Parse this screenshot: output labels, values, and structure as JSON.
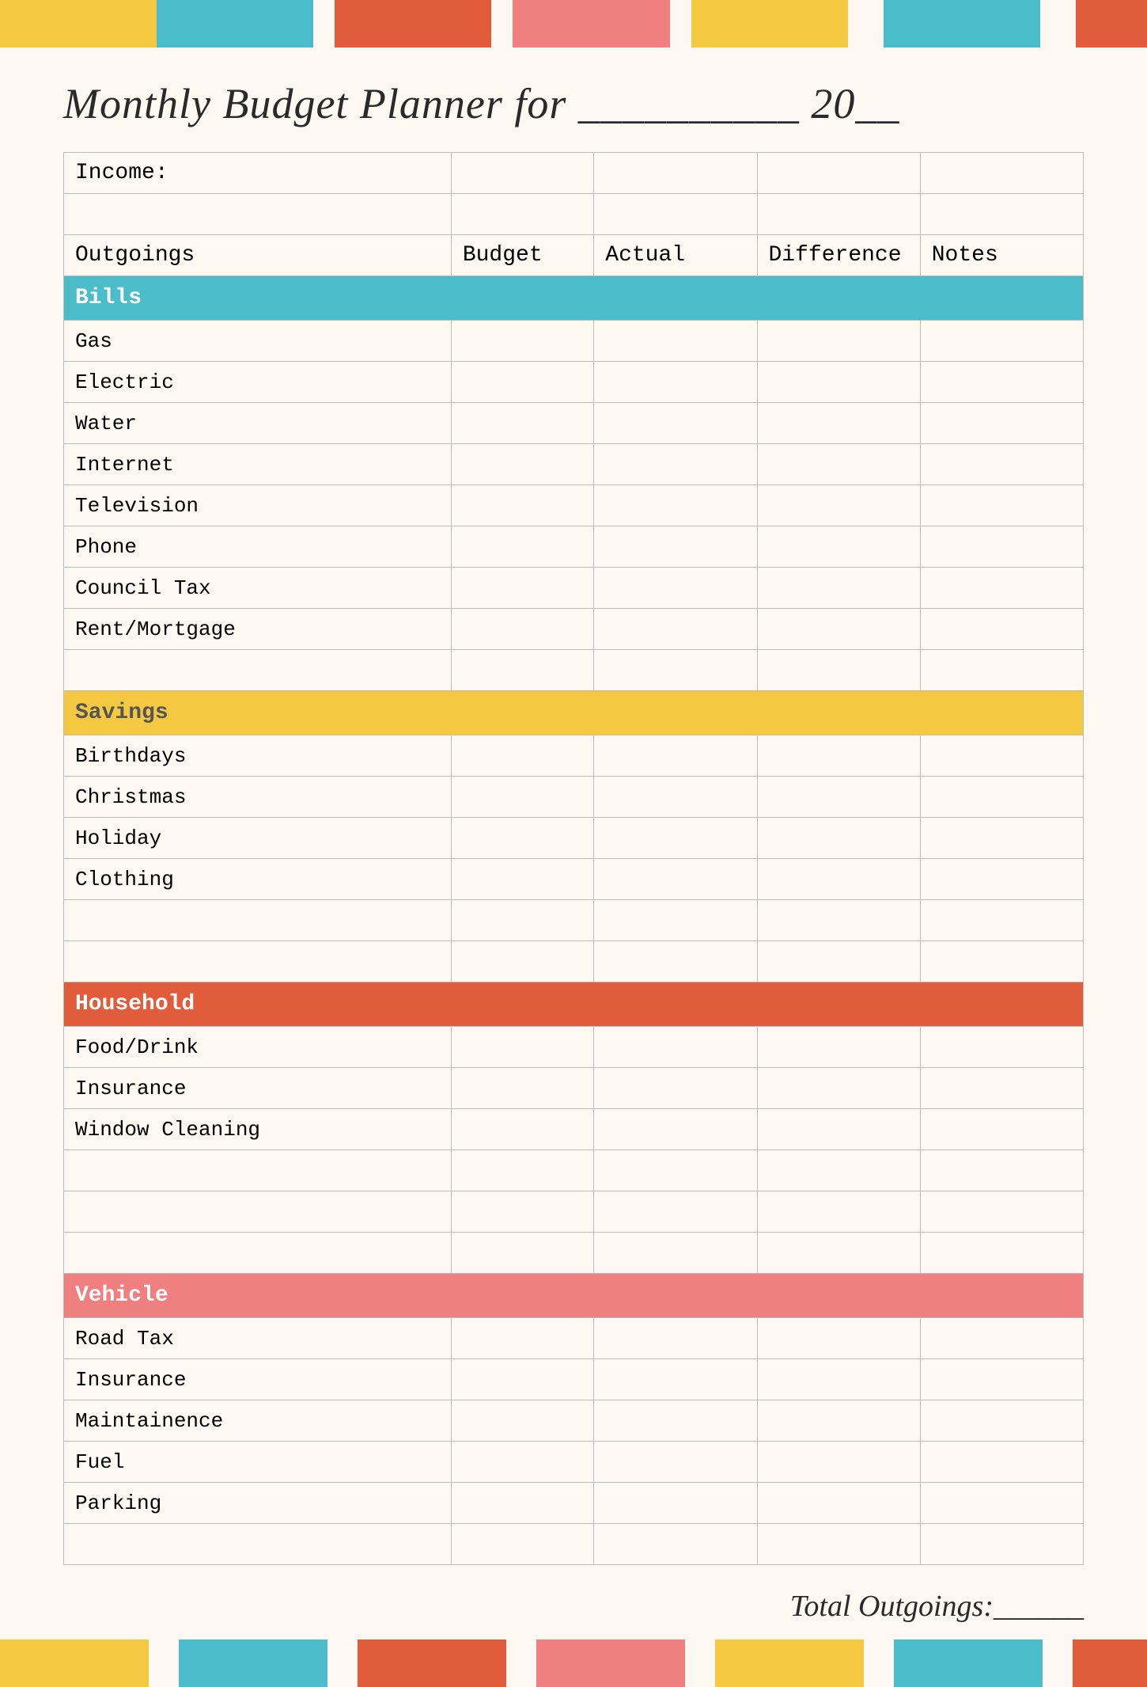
{
  "title": "Monthly Budget Planner for __________ 20__",
  "colors": {
    "yellow": "#f5c842",
    "teal": "#4abcca",
    "red": "#e05c3a",
    "pink": "#f08080",
    "light_yellow": "#f5c842",
    "light_teal": "#4abcca"
  },
  "top_bar_segments": [
    {
      "color": "#f5c842",
      "flex": 2
    },
    {
      "color": "#4abcca",
      "flex": 2
    },
    {
      "color": "#e05c3a",
      "flex": 2
    },
    {
      "color": "#f08080",
      "flex": 2
    },
    {
      "color": "#f5c842",
      "flex": 2
    },
    {
      "color": "#fdf8f2",
      "flex": 1
    },
    {
      "color": "#4abcca",
      "flex": 2
    },
    {
      "color": "#fdf8f2",
      "flex": 1
    },
    {
      "color": "#e05c3a",
      "flex": 1
    }
  ],
  "bottom_bar_segments": [
    {
      "color": "#f5c842",
      "flex": 2
    },
    {
      "color": "#fdf8f2",
      "flex": 1
    },
    {
      "color": "#4abcca",
      "flex": 2
    },
    {
      "color": "#fdf8f2",
      "flex": 1
    },
    {
      "color": "#e05c3a",
      "flex": 2
    },
    {
      "color": "#fdf8f2",
      "flex": 1
    },
    {
      "color": "#f08080",
      "flex": 2
    },
    {
      "color": "#fdf8f2",
      "flex": 1
    },
    {
      "color": "#f5c842",
      "flex": 2
    },
    {
      "color": "#fdf8f2",
      "flex": 1
    },
    {
      "color": "#4abcca",
      "flex": 2
    },
    {
      "color": "#fdf8f2",
      "flex": 1
    },
    {
      "color": "#e05c3a",
      "flex": 1
    }
  ],
  "columns": {
    "label": "Outgoings",
    "budget": "Budget",
    "actual": "Actual",
    "difference": "Difference",
    "notes": "Notes"
  },
  "income_label": "Income:",
  "sections": {
    "bills": {
      "label": "Bills",
      "items": [
        "Gas",
        "Electric",
        "Water",
        "Internet",
        "Television",
        "Phone",
        "Council Tax",
        "Rent/Mortgage"
      ]
    },
    "savings": {
      "label": "Savings",
      "items": [
        "Birthdays",
        "Christmas",
        "Holiday",
        "Clothing"
      ]
    },
    "household": {
      "label": "Household",
      "items": [
        "Food/Drink",
        "Insurance",
        "Window Cleaning"
      ]
    },
    "vehicle": {
      "label": "Vehicle",
      "items": [
        "Road Tax",
        "Insurance",
        "Maintainence",
        "Fuel",
        "Parking"
      ]
    }
  },
  "total_label": "Total Outgoings:______"
}
